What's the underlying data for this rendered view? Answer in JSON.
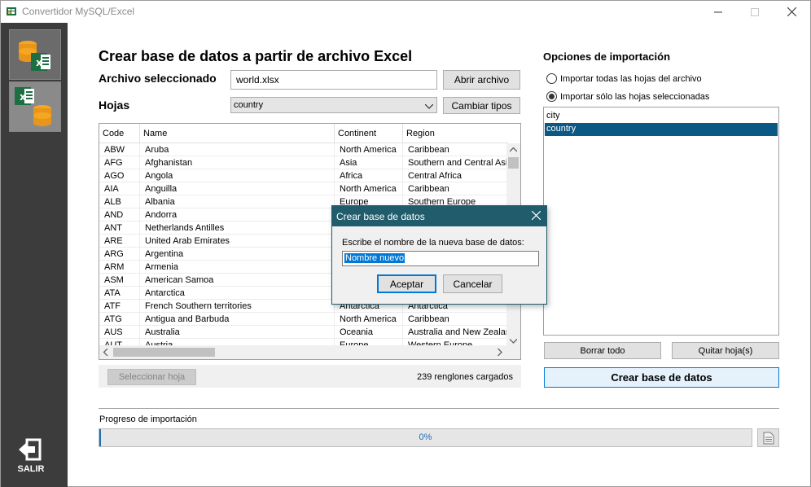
{
  "window": {
    "title": "Convertidor MySQL/Excel",
    "icons": [
      "app-icon",
      "minimize-icon",
      "maximize-icon",
      "close-icon"
    ]
  },
  "sidebar": {
    "tabs": [
      {
        "icon": "mysql-to-excel-icon",
        "active": true
      },
      {
        "icon": "excel-to-mysql-icon",
        "active": false
      }
    ],
    "exit_label": "SALIR",
    "exit_icon": "exit-icon"
  },
  "main": {
    "heading": "Crear base de datos a partir de archivo Excel",
    "file_label": "Archivo seleccionado",
    "file_value": "world.xlsx",
    "open_file_button": "Abrir archivo",
    "sheets_label": "Hojas",
    "sheet_selected": "country",
    "change_types_button": "Cambiar tipos",
    "grid": {
      "columns": [
        "Code",
        "Name",
        "Continent",
        "Region"
      ],
      "rows": [
        [
          "ABW",
          "Aruba",
          "North America",
          "Caribbean"
        ],
        [
          "AFG",
          "Afghanistan",
          "Asia",
          "Southern and Central Asia"
        ],
        [
          "AGO",
          "Angola",
          "Africa",
          "Central Africa"
        ],
        [
          "AIA",
          "Anguilla",
          "North America",
          "Caribbean"
        ],
        [
          "ALB",
          "Albania",
          "Europe",
          "Southern Europe"
        ],
        [
          "AND",
          "Andorra",
          "",
          ""
        ],
        [
          "ANT",
          "Netherlands Antilles",
          "",
          ""
        ],
        [
          "ARE",
          "United Arab Emirates",
          "",
          ""
        ],
        [
          "ARG",
          "Argentina",
          "",
          ""
        ],
        [
          "ARM",
          "Armenia",
          "",
          ""
        ],
        [
          "ASM",
          "American Samoa",
          "",
          ""
        ],
        [
          "ATA",
          "Antarctica",
          "",
          ""
        ],
        [
          "ATF",
          "French Southern territories",
          "Antarctica",
          "Antarctica"
        ],
        [
          "ATG",
          "Antigua and Barbuda",
          "North America",
          "Caribbean"
        ],
        [
          "AUS",
          "Australia",
          "Oceania",
          "Australia and New Zealand"
        ],
        [
          "AUT",
          "Austria",
          "Europe",
          "Western Europe"
        ]
      ]
    },
    "select_sheet_button": "Seleccionar hoja",
    "rows_loaded": "239 renglones cargados"
  },
  "options": {
    "title": "Opciones de importación",
    "radio_all": "Importar todas las hojas del archivo",
    "radio_selected": "Importar sólo las hojas seleccionadas",
    "selected_mode": "selected",
    "sheets": [
      {
        "name": "city",
        "selected": false
      },
      {
        "name": "country",
        "selected": true
      }
    ],
    "clear_all_button": "Borrar todo",
    "remove_sheet_button": "Quitar hoja(s)",
    "create_db_button": "Crear base de datos"
  },
  "progress": {
    "label": "Progreso de importación",
    "value": 0,
    "text": "0%",
    "log_icon": "document-icon"
  },
  "dialog": {
    "title": "Crear base de datos",
    "prompt": "Escribe el nombre de la nueva base de datos:",
    "input_value": "Nombre nuevo",
    "accept_button": "Aceptar",
    "cancel_button": "Cancelar"
  },
  "colors": {
    "sidebar_bg": "#3c3c3c",
    "selection": "#0c5884",
    "dialog_title": "#215c6c",
    "accent": "#0078d7"
  }
}
